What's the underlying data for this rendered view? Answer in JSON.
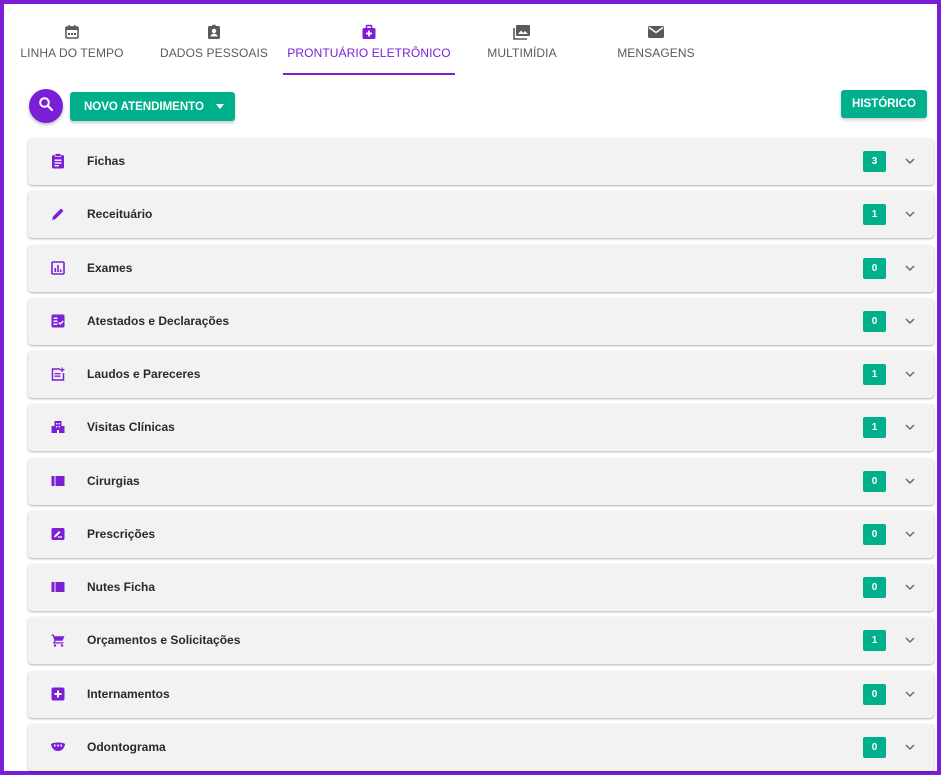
{
  "tabs": [
    {
      "label": "LINHA DO TEMPO",
      "icon": "calendar-icon",
      "active": false
    },
    {
      "label": "DADOS PESSOAIS",
      "icon": "contact-card-icon",
      "active": false
    },
    {
      "label": "PRONTUÁRIO ELETRÔNICO",
      "icon": "medical-bag-icon",
      "active": true
    },
    {
      "label": "MULTIMÍDIA",
      "icon": "photo-library-icon",
      "active": false
    },
    {
      "label": "MENSAGENS",
      "icon": "mail-icon",
      "active": false
    }
  ],
  "toolbar": {
    "search_icon": "search-icon",
    "novo_atendimento_label": "NOVO ATENDIMENTO",
    "historico_label": "HISTÓRICO"
  },
  "panels": [
    {
      "label": "Fichas",
      "count": "3",
      "icon": "clipboard-icon"
    },
    {
      "label": "Receituário",
      "count": "1",
      "icon": "pencil-icon"
    },
    {
      "label": "Exames",
      "count": "0",
      "icon": "bar-chart-icon"
    },
    {
      "label": "Atestados e Declarações",
      "count": "0",
      "icon": "checklist-icon"
    },
    {
      "label": "Laudos e Pareceres",
      "count": "1",
      "icon": "post-add-icon"
    },
    {
      "label": "Visitas Clínicas",
      "count": "1",
      "icon": "hospital-building-icon"
    },
    {
      "label": "Cirurgias",
      "count": "0",
      "icon": "view-column-icon"
    },
    {
      "label": "Prescrições",
      "count": "0",
      "icon": "edit-box-icon"
    },
    {
      "label": "Nutes Ficha",
      "count": "0",
      "icon": "view-column-icon"
    },
    {
      "label": "Orçamentos e Solicitações",
      "count": "1",
      "icon": "cart-icon"
    },
    {
      "label": "Internamentos",
      "count": "0",
      "icon": "local-hospital-icon"
    },
    {
      "label": "Odontograma",
      "count": "0",
      "icon": "dentures-icon"
    }
  ],
  "colors": {
    "accent": "#7b1fd6",
    "button": "#00b08a",
    "panel_bg": "#f2f2f2"
  }
}
